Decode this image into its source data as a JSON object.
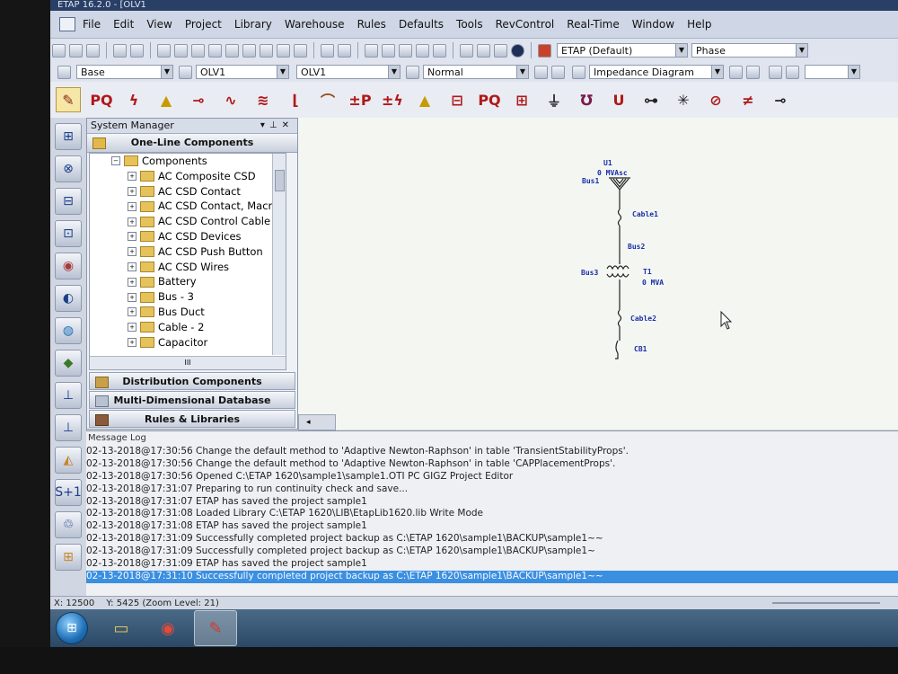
{
  "window": {
    "title": "ETAP 16.2.0 - [OLV1"
  },
  "menu": [
    "File",
    "Edit",
    "View",
    "Project",
    "Library",
    "Warehouse",
    "Rules",
    "Defaults",
    "Tools",
    "RevControl",
    "Real-Time",
    "Window",
    "Help"
  ],
  "toolbar": {
    "config_combo": "ETAP (Default)",
    "phase_combo": "Phase",
    "base_combo": "Base",
    "olv_combo_1": "OLV1",
    "olv_combo_2": "OLV1",
    "mode_combo": "Normal",
    "diagram_combo": "Impedance Diagram"
  },
  "system_manager": {
    "title": "System Manager",
    "section": "One-Line Components",
    "tree_root": "Components",
    "tree_items": [
      "AC Composite CSD",
      "AC CSD Contact",
      "AC CSD Contact, Macro-Ctr",
      "AC CSD Control Cable",
      "AC CSD Devices",
      "AC CSD Push Button",
      "AC CSD Wires",
      "Battery",
      "Bus - 3",
      "Bus Duct",
      "Cable - 2",
      "Capacitor"
    ],
    "hscroll_label": "III",
    "nav": [
      "Distribution Components",
      "Multi-Dimensional Database",
      "Rules & Libraries"
    ]
  },
  "diagram": {
    "u1": "U1",
    "u1_rating": "0 MVAsc",
    "bus1": "Bus1",
    "cable1": "Cable1",
    "bus2": "Bus2",
    "bus3": "Bus3",
    "t1": "T1",
    "t1_rating": "0 MVA",
    "cable2": "Cable2",
    "cb1": "CB1"
  },
  "message_log": {
    "title": "Message Log",
    "lines": [
      "02-13-2018@17:30:56 Change the default method to 'Adaptive Newton-Raphson' in table 'TransientStabilityProps'.",
      "02-13-2018@17:30:56 Change the default method to 'Adaptive Newton-Raphson' in table 'CAPPlacementProps'.",
      "02-13-2018@17:30:56 Opened C:\\ETAP 1620\\sample1\\sample1.OTI PC GIGZ Project Editor",
      "02-13-2018@17:31:07 Preparing to run continuity check and save...",
      "02-13-2018@17:31:07 ETAP has saved the project sample1",
      "02-13-2018@17:31:08 Loaded Library C:\\ETAP 1620\\LIB\\EtapLib1620.lib Write Mode",
      "02-13-2018@17:31:08 ETAP has saved the project sample1",
      "02-13-2018@17:31:09 Successfully completed project backup as C:\\ETAP 1620\\sample1\\BACKUP\\sample1~~",
      "02-13-2018@17:31:09 Successfully completed project backup as C:\\ETAP 1620\\sample1\\BACKUP\\sample1~",
      "02-13-2018@17:31:09 ETAP has saved the project sample1",
      "02-13-2018@17:31:10 Successfully completed project backup as C:\\ETAP 1620\\sample1\\BACKUP\\sample1~~"
    ]
  },
  "status": {
    "x": "X: 12500",
    "y": "Y: 5425 (Zoom Level: 21)"
  },
  "colors": {
    "accent_selection": "#3b8fe0",
    "diagram_label": "#1a2fa8",
    "diagram_line": "#222222"
  }
}
